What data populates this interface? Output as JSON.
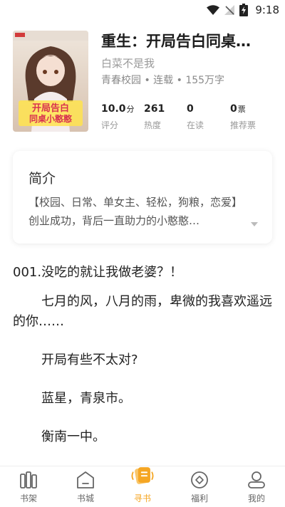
{
  "status_bar": {
    "time": "9:18"
  },
  "book": {
    "title": "重生：开局告白同桌…",
    "author": "白菜不是我",
    "meta": "青春校园 • 连载 • 155万字",
    "stats": [
      {
        "value": "10.0",
        "unit": "分",
        "label": "评分"
      },
      {
        "value": "261",
        "unit": "",
        "label": "热度"
      },
      {
        "value": "0",
        "unit": "",
        "label": "在读"
      },
      {
        "value": "0",
        "unit": "票",
        "label": "推荐票"
      }
    ]
  },
  "intro": {
    "heading": "简介",
    "text": "【校园、日常、单女主、轻松，狗粮，恋爱】创业成功，背后一直助力的小憨憨…"
  },
  "chapter": {
    "title": "001.没吃的就让我做老婆？！",
    "paragraphs": [
      "七月的风，八月的雨，卑微的我喜欢遥远的你……",
      "开局有些不太对?",
      "蓝星，青泉市。",
      "衡南一中。"
    ]
  },
  "bottom_nav": {
    "items": [
      {
        "label": "书架",
        "icon": "bookshelf-icon"
      },
      {
        "label": "书城",
        "icon": "bookstore-icon"
      },
      {
        "label": "寻书",
        "icon": "find-book-icon"
      },
      {
        "label": "福利",
        "icon": "rewards-icon"
      },
      {
        "label": "我的",
        "icon": "profile-icon"
      }
    ],
    "active_index": 2
  },
  "colors": {
    "accent": "#f5a623",
    "text": "#222222",
    "muted": "#999999"
  }
}
